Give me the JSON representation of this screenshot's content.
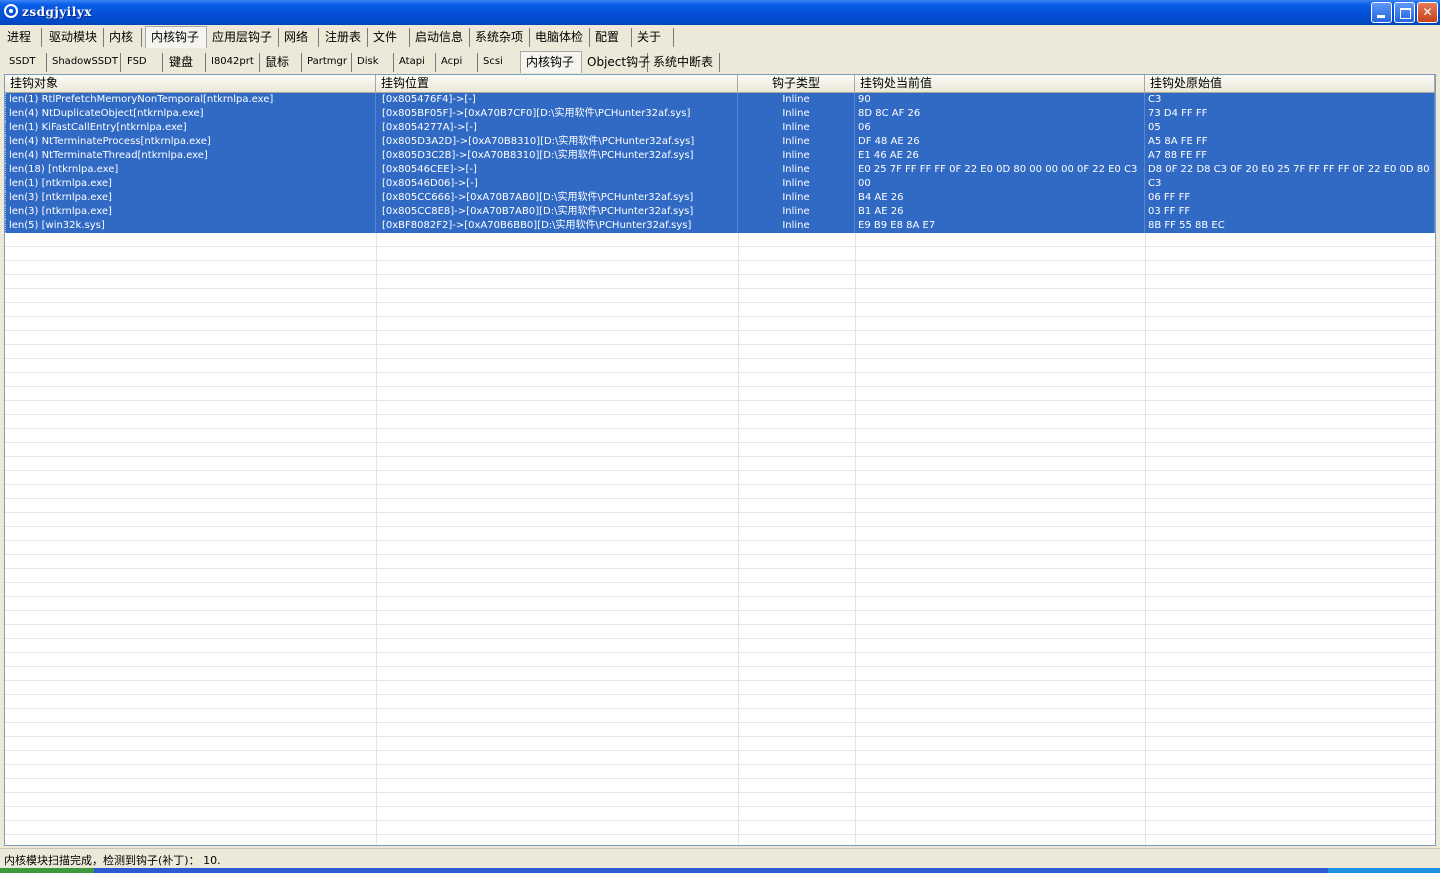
{
  "window": {
    "title": "zsdgjyilyx",
    "minimize_glyph": "minimize-icon",
    "maximize_glyph": "restore-icon",
    "close_glyph": "close-icon",
    "close_label": "✕"
  },
  "tabs_main": [
    {
      "label": "进程"
    },
    {
      "label": "驱动模块"
    },
    {
      "label": "内核"
    },
    {
      "label": "内核钩子",
      "active": true
    },
    {
      "label": "应用层钩子"
    },
    {
      "label": "网络"
    },
    {
      "label": "注册表"
    },
    {
      "label": "文件"
    },
    {
      "label": "启动信息"
    },
    {
      "label": "系统杂项"
    },
    {
      "label": "电脑体检"
    },
    {
      "label": "配置"
    },
    {
      "label": "关于"
    }
  ],
  "tabs_sub": [
    {
      "label": "SSDT"
    },
    {
      "label": "ShadowSSDT"
    },
    {
      "label": "FSD"
    },
    {
      "label": "键盘"
    },
    {
      "label": "I8042prt"
    },
    {
      "label": "鼠标"
    },
    {
      "label": "Partmgr"
    },
    {
      "label": "Disk"
    },
    {
      "label": "Atapi"
    },
    {
      "label": "Acpi"
    },
    {
      "label": "Scsi"
    },
    {
      "label": "内核钩子",
      "active": true
    },
    {
      "label": "Object钩子"
    },
    {
      "label": "系统中断表"
    }
  ],
  "table": {
    "columns": [
      "挂钩对象",
      "挂钩位置",
      "钩子类型",
      "挂钩处当前值",
      "挂钩处原始值"
    ],
    "rows": [
      [
        "len(1) RtlPrefetchMemoryNonTemporal[ntkrnlpa.exe]",
        "[0x805476F4]->[-]",
        "Inline",
        "90",
        "C3"
      ],
      [
        "len(4) NtDuplicateObject[ntkrnlpa.exe]",
        "[0x805BF05F]->[0xA70B7CF0][D:\\实用软件\\PCHunter32af.sys]",
        "Inline",
        "8D 8C AF 26",
        "73 D4 FF FF"
      ],
      [
        "len(1) KiFastCallEntry[ntkrnlpa.exe]",
        "[0x8054277A]->[-]",
        "Inline",
        "06",
        "05"
      ],
      [
        "len(4) NtTerminateProcess[ntkrnlpa.exe]",
        "[0x805D3A2D]->[0xA70B8310][D:\\实用软件\\PCHunter32af.sys]",
        "Inline",
        "DF 48 AE 26",
        "A5 8A FE FF"
      ],
      [
        "len(4) NtTerminateThread[ntkrnlpa.exe]",
        "[0x805D3C2B]->[0xA70B8310][D:\\实用软件\\PCHunter32af.sys]",
        "Inline",
        "E1 46 AE 26",
        "A7 88 FE FF"
      ],
      [
        "len(18) [ntkrnlpa.exe]",
        "[0x80546CEE]->[-]",
        "Inline",
        "E0 25 7F FF FF FF 0F 22 E0 0D 80 00 00 00 0F 22 E0 C3",
        "D8 0F 22 D8 C3 0F 20 E0 25 7F FF FF FF 0F 22 E0 0D 80"
      ],
      [
        "len(1) [ntkrnlpa.exe]",
        "[0x80546D06]->[-]",
        "Inline",
        "00",
        "C3"
      ],
      [
        "len(3) [ntkrnlpa.exe]",
        "[0x805CC666]->[0xA70B7AB0][D:\\实用软件\\PCHunter32af.sys]",
        "Inline",
        "B4 AE 26",
        "06 FF FF"
      ],
      [
        "len(3) [ntkrnlpa.exe]",
        "[0x805CC8E8]->[0xA70B7AB0][D:\\实用软件\\PCHunter32af.sys]",
        "Inline",
        "B1 AE 26",
        "03 FF FF"
      ],
      [
        "len(5) [win32k.sys]",
        "[0xBF8082F2]->[0xA70B6BB0][D:\\实用软件\\PCHunter32af.sys]",
        "Inline",
        "E9 B9 E8 8A E7",
        "8B FF 55 8B EC"
      ]
    ]
  },
  "status": {
    "text": "内核模块扫描完成，检测到钩子(补丁)： 10."
  },
  "colors": {
    "selection": "#316ac5",
    "titlebar": "#0450d8",
    "window_bg": "#ece9d8"
  }
}
